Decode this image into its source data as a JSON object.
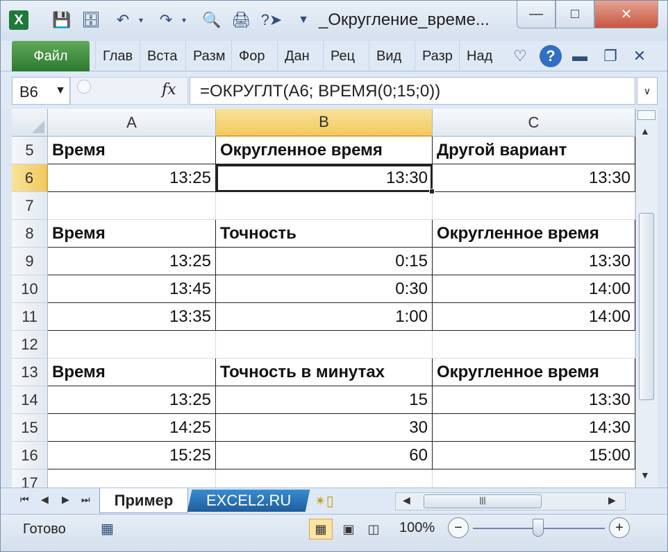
{
  "window": {
    "title": "_Округление_време...",
    "app_icon": "X"
  },
  "quick_access": [
    "save-icon",
    "save-as-icon",
    "undo-icon",
    "redo-icon",
    "print-preview-icon",
    "print-icon",
    "help-arrow-icon"
  ],
  "ribbon": {
    "file_label": "Файл",
    "tabs": [
      "Глав",
      "Вста",
      "Разм",
      "Фор",
      "Дан",
      "Рец",
      "Вид",
      "Разр",
      "Над"
    ]
  },
  "formula_bar": {
    "name_box": "B6",
    "fx_label": "fx",
    "formula": "=ОКРУГЛТ(A6; ВРЕМЯ(0;15;0))"
  },
  "grid": {
    "columns": [
      "A",
      "B",
      "C"
    ],
    "selected_column": "B",
    "selected_row": "6",
    "rows": [
      {
        "n": "5",
        "a": "Время",
        "b": "Округленное время",
        "c": "Другой вариант"
      },
      {
        "n": "6",
        "a": "13:25",
        "b": "13:30",
        "c": "13:30"
      },
      {
        "n": "7",
        "a": "",
        "b": "",
        "c": ""
      },
      {
        "n": "8",
        "a": "Время",
        "b": "Точность",
        "c": "Округленное время"
      },
      {
        "n": "9",
        "a": "13:25",
        "b": "0:15",
        "c": "13:30"
      },
      {
        "n": "10",
        "a": "13:45",
        "b": "0:30",
        "c": "14:00"
      },
      {
        "n": "11",
        "a": "13:35",
        "b": "1:00",
        "c": "14:00"
      },
      {
        "n": "12",
        "a": "",
        "b": "",
        "c": ""
      },
      {
        "n": "13",
        "a": "Время",
        "b": "Точность в минутах",
        "c": "Округленное время"
      },
      {
        "n": "14",
        "a": "13:25",
        "b": "15",
        "c": "13:30"
      },
      {
        "n": "15",
        "a": "14:25",
        "b": "30",
        "c": "14:30"
      },
      {
        "n": "16",
        "a": "15:25",
        "b": "60",
        "c": "15:00"
      },
      {
        "n": "17",
        "a": "",
        "b": "",
        "c": ""
      }
    ]
  },
  "sheet_tabs": {
    "active": "Пример",
    "other": "EXCEL2.RU"
  },
  "status_bar": {
    "status": "Готово",
    "zoom": "100%",
    "zoom_level_percent": 100
  }
}
